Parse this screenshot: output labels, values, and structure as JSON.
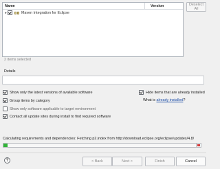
{
  "table": {
    "columns": [
      "Name",
      "Version"
    ],
    "rows": [
      {
        "label": "Maven Integration for Eclipse",
        "version": "",
        "checked": true,
        "expanded": false,
        "icon": "feature-group-icon"
      }
    ]
  },
  "buttons": {
    "deselect_all": "Deselect All",
    "back": "< Back",
    "next": "Next >",
    "finish": "Finish",
    "cancel": "Cancel"
  },
  "selection_status": "2 items selected",
  "details": {
    "label": "Details",
    "value": ""
  },
  "options": {
    "show_latest": {
      "label": "Show only the latest versions of available software",
      "checked": true
    },
    "group_by_category": {
      "label": "Group items by category",
      "checked": true
    },
    "applicable_only": {
      "label": "Show only software applicable to target environment",
      "checked": false
    },
    "contact_all_sites": {
      "label": "Contact all update sites during install to find required software",
      "checked": true
    },
    "hide_installed": {
      "label": "Hide items that are already installed",
      "checked": true
    },
    "what_is_installed_prefix": "What is",
    "already_installed_link": "already installed",
    "what_is_installed_suffix": "?"
  },
  "status": "Calculating requirements and dependencies: Fetching p2.index from http://download.eclipse.org/eclipse/updates/4.8/",
  "progress": {
    "fraction": 0.02,
    "color": "#31b437"
  },
  "colors": {
    "stop": "#d23a3a",
    "link": "#1f4fa8"
  },
  "icons": {
    "help": "help-icon",
    "stop": "stop-icon",
    "expander": "chevron-right-icon"
  }
}
